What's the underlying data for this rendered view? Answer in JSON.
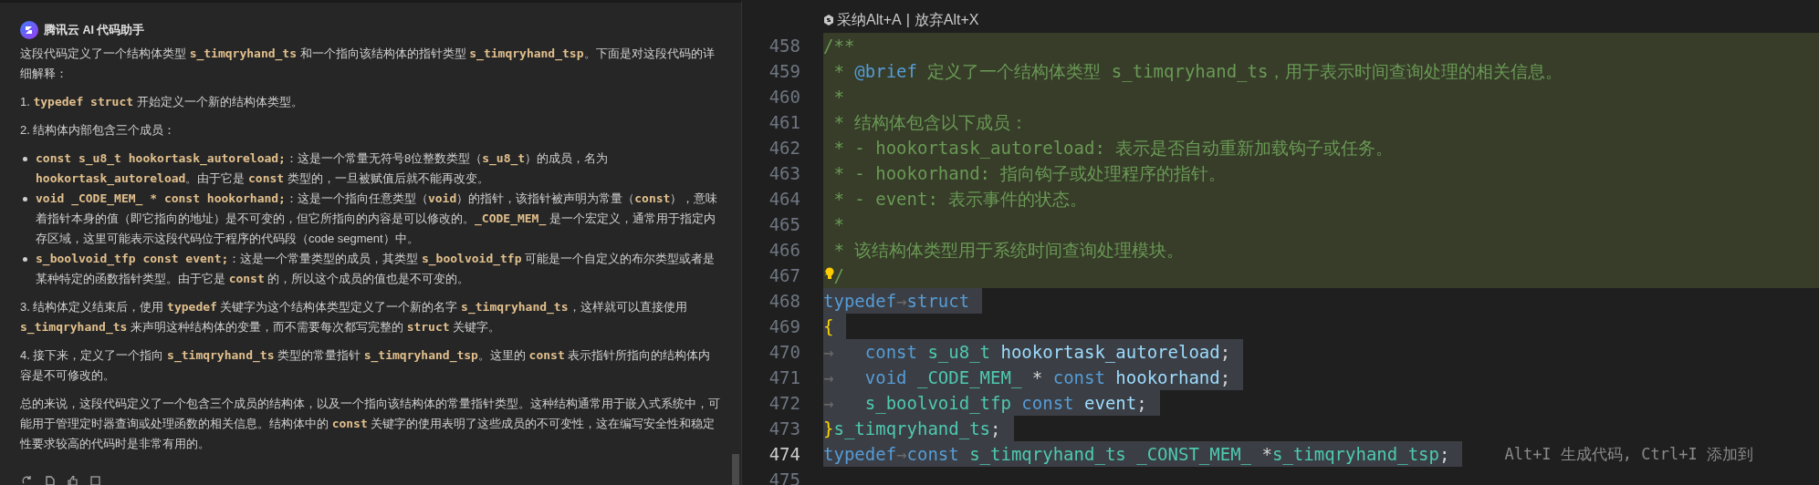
{
  "assistant": {
    "title": "腾讯云 AI 代码助手",
    "blocks": [
      {
        "kind": "paragraph",
        "parts": [
          {
            "text": "这段代码定义了一个结构体类型 ",
            "kind": "text"
          },
          {
            "text": "s_timqryhand_ts",
            "kind": "code"
          },
          {
            "text": " 和一个指向该结构体的指针类型 ",
            "kind": "text"
          },
          {
            "text": "s_timqryhand_tsp",
            "kind": "code"
          },
          {
            "text": "。下面是对这段代码的详细解释：",
            "kind": "text"
          }
        ]
      },
      {
        "kind": "paragraph",
        "parts": [
          {
            "text": "1. ",
            "kind": "text"
          },
          {
            "text": "typedef struct",
            "kind": "code"
          },
          {
            "text": " 开始定义一个新的结构体类型。",
            "kind": "text"
          }
        ]
      },
      {
        "kind": "paragraph",
        "parts": [
          {
            "text": "2. 结构体内部包含三个成员：",
            "kind": "text"
          }
        ]
      },
      {
        "kind": "bullets",
        "items": [
          {
            "parts": [
              {
                "text": "const s_u8_t hookortask_autoreload;",
                "kind": "code"
              },
              {
                "text": "：这是一个常量无符号8位整数类型（",
                "kind": "text"
              },
              {
                "text": "s_u8_t",
                "kind": "code"
              },
              {
                "text": "）的成员，名为 ",
                "kind": "text"
              },
              {
                "text": "hookortask_autoreload",
                "kind": "code"
              },
              {
                "text": "。由于它是 ",
                "kind": "text"
              },
              {
                "text": "const",
                "kind": "code"
              },
              {
                "text": " 类型的，一旦被赋值后就不能再改变。",
                "kind": "text"
              }
            ]
          },
          {
            "parts": [
              {
                "text": "void _CODE_MEM_ * const hookorhand;",
                "kind": "code"
              },
              {
                "text": "：这是一个指向任意类型（",
                "kind": "text"
              },
              {
                "text": "void",
                "kind": "code"
              },
              {
                "text": "）的指针，该指针被声明为常量（",
                "kind": "text"
              },
              {
                "text": "const",
                "kind": "code"
              },
              {
                "text": "），意味着指针本身的值（即它指向的地址）是不可变的，但它所指向的内容是可以修改的。",
                "kind": "text"
              },
              {
                "text": "_CODE_MEM_",
                "kind": "code"
              },
              {
                "text": " 是一个宏定义，通常用于指定内存区域，这里可能表示这段代码位于程序的代码段（code segment）中。",
                "kind": "text"
              }
            ]
          },
          {
            "parts": [
              {
                "text": "s_boolvoid_tfp const event;",
                "kind": "code"
              },
              {
                "text": "：这是一个常量类型的成员，其类型 ",
                "kind": "text"
              },
              {
                "text": "s_boolvoid_tfp",
                "kind": "code"
              },
              {
                "text": " 可能是一个自定义的布尔类型或者是某种特定的函数指针类型。由于它是 ",
                "kind": "text"
              },
              {
                "text": "const",
                "kind": "code"
              },
              {
                "text": " 的，所以这个成员的值也是不可变的。",
                "kind": "text"
              }
            ]
          }
        ]
      },
      {
        "kind": "paragraph",
        "parts": [
          {
            "text": "3. 结构体定义结束后，使用 ",
            "kind": "text"
          },
          {
            "text": "typedef",
            "kind": "code"
          },
          {
            "text": " 关键字为这个结构体类型定义了一个新的名字 ",
            "kind": "text"
          },
          {
            "text": "s_timqryhand_ts",
            "kind": "code"
          },
          {
            "text": "，这样就可以直接使用 ",
            "kind": "text"
          },
          {
            "text": "s_timqryhand_ts",
            "kind": "code"
          },
          {
            "text": " 来声明这种结构体的变量，而不需要每次都写完整的 ",
            "kind": "text"
          },
          {
            "text": "struct",
            "kind": "code"
          },
          {
            "text": " 关键字。",
            "kind": "text"
          }
        ]
      },
      {
        "kind": "paragraph",
        "parts": [
          {
            "text": "4. 接下来，定义了一个指向 ",
            "kind": "text"
          },
          {
            "text": "s_timqryhand_ts",
            "kind": "code"
          },
          {
            "text": " 类型的常量指针 ",
            "kind": "text"
          },
          {
            "text": "s_timqryhand_tsp",
            "kind": "code"
          },
          {
            "text": "。这里的 ",
            "kind": "text"
          },
          {
            "text": "const",
            "kind": "code"
          },
          {
            "text": " 表示指针所指向的结构体内容是不可修改的。",
            "kind": "text"
          }
        ]
      },
      {
        "kind": "paragraph",
        "parts": [
          {
            "text": "总的来说，这段代码定义了一个包含三个成员的结构体，以及一个指向该结构体的常量指针类型。这种结构通常用于嵌入式系统中，可能用于管理定时器查询或处理函数的相关信息。结构体中的 ",
            "kind": "text"
          },
          {
            "text": "const",
            "kind": "code"
          },
          {
            "text": " 关键字的使用表明了这些成员的不可变性，这在编写安全性和稳定性要求较高的代码时是非常有用的。",
            "kind": "text"
          }
        ]
      }
    ]
  },
  "editor": {
    "codelens": {
      "actions": [
        "采纳Alt+A",
        "放弃Alt+X"
      ],
      "separator": "|"
    },
    "lines": [
      {
        "number": "458",
        "kind": "suggestion",
        "current": false,
        "lightbulb": false,
        "tokens": [
          {
            "text": "/**",
            "kind": "comment"
          }
        ]
      },
      {
        "number": "459",
        "kind": "suggestion",
        "current": false,
        "lightbulb": false,
        "tokens": [
          {
            "text": " * ",
            "kind": "comment"
          },
          {
            "text": "@brief",
            "kind": "tag"
          },
          {
            "text": " 定义了一个结构体类型 s_timqryhand_ts，用于表示时间查询处理的相关信息。",
            "kind": "comment"
          }
        ]
      },
      {
        "number": "460",
        "kind": "suggestion",
        "current": false,
        "lightbulb": false,
        "tokens": [
          {
            "text": " *",
            "kind": "comment"
          }
        ]
      },
      {
        "number": "461",
        "kind": "suggestion",
        "current": false,
        "lightbulb": false,
        "tokens": [
          {
            "text": " * 结构体包含以下成员：",
            "kind": "comment"
          }
        ]
      },
      {
        "number": "462",
        "kind": "suggestion",
        "current": false,
        "lightbulb": false,
        "tokens": [
          {
            "text": " * - hookortask_autoreload: 表示是否自动重新加载钩子或任务。",
            "kind": "comment"
          }
        ]
      },
      {
        "number": "463",
        "kind": "suggestion",
        "current": false,
        "lightbulb": false,
        "tokens": [
          {
            "text": " * - hookorhand: 指向钩子或处理程序的指针。",
            "kind": "comment"
          }
        ]
      },
      {
        "number": "464",
        "kind": "suggestion",
        "current": false,
        "lightbulb": false,
        "tokens": [
          {
            "text": " * - event: 表示事件的状态。",
            "kind": "comment"
          }
        ]
      },
      {
        "number": "465",
        "kind": "suggestion",
        "current": false,
        "lightbulb": false,
        "tokens": [
          {
            "text": " *",
            "kind": "comment"
          }
        ]
      },
      {
        "number": "466",
        "kind": "suggestion",
        "current": false,
        "lightbulb": false,
        "tokens": [
          {
            "text": " * 该结构体类型用于系统时间查询处理模块。",
            "kind": "comment"
          }
        ]
      },
      {
        "number": "467",
        "kind": "suggestion",
        "current": false,
        "lightbulb": true,
        "tokens": [
          {
            "text": "*/",
            "kind": "comment"
          }
        ]
      },
      {
        "number": "468",
        "kind": "selection",
        "current": false,
        "lightbulb": false,
        "tokens": [
          {
            "text": "typedef",
            "kind": "keyword"
          },
          {
            "text": "→",
            "kind": "whitespace"
          },
          {
            "text": "struct",
            "kind": "keyword"
          }
        ]
      },
      {
        "number": "469",
        "kind": "selection",
        "current": false,
        "lightbulb": false,
        "tokens": [
          {
            "text": "{",
            "kind": "brace"
          }
        ]
      },
      {
        "number": "470",
        "kind": "selection",
        "current": false,
        "lightbulb": false,
        "tokens": [
          {
            "text": "→   ",
            "kind": "whitespace"
          },
          {
            "text": "const ",
            "kind": "keyword"
          },
          {
            "text": "s_u8_t ",
            "kind": "type"
          },
          {
            "text": "hookortask_autoreload",
            "kind": "variable"
          },
          {
            "text": ";",
            "kind": "plain"
          }
        ]
      },
      {
        "number": "471",
        "kind": "selection",
        "current": false,
        "lightbulb": false,
        "tokens": [
          {
            "text": "→   ",
            "kind": "whitespace"
          },
          {
            "text": "void ",
            "kind": "keyword"
          },
          {
            "text": "_CODE_MEM_",
            "kind": "type"
          },
          {
            "text": " * ",
            "kind": "plain"
          },
          {
            "text": "const ",
            "kind": "keyword"
          },
          {
            "text": "hookorhand",
            "kind": "variable"
          },
          {
            "text": ";",
            "kind": "plain"
          }
        ]
      },
      {
        "number": "472",
        "kind": "selection",
        "current": false,
        "lightbulb": false,
        "tokens": [
          {
            "text": "→   ",
            "kind": "whitespace"
          },
          {
            "text": "s_boolvoid_tfp ",
            "kind": "type"
          },
          {
            "text": "const ",
            "kind": "keyword"
          },
          {
            "text": "event",
            "kind": "variable"
          },
          {
            "text": ";",
            "kind": "plain"
          }
        ]
      },
      {
        "number": "473",
        "kind": "selection",
        "current": false,
        "lightbulb": false,
        "tokens": [
          {
            "text": "}",
            "kind": "brace"
          },
          {
            "text": "s_timqryhand_ts",
            "kind": "type"
          },
          {
            "text": ";",
            "kind": "plain"
          }
        ]
      },
      {
        "number": "474",
        "kind": "selection",
        "current": true,
        "lightbulb": false,
        "hint": "Alt+I 生成代码, Ctrl+I 添加到",
        "tokens": [
          {
            "text": "typedef",
            "kind": "keyword"
          },
          {
            "text": "→",
            "kind": "whitespace"
          },
          {
            "text": "const ",
            "kind": "keyword"
          },
          {
            "text": "s_timqryhand_ts ",
            "kind": "type"
          },
          {
            "text": "_CONST_MEM_",
            "kind": "type"
          },
          {
            "text": " *",
            "kind": "plain"
          },
          {
            "text": "s_timqryhand_tsp",
            "kind": "type"
          },
          {
            "text": ";",
            "kind": "plain"
          }
        ]
      },
      {
        "number": "475",
        "kind": "plain",
        "current": false,
        "lightbulb": false
      }
    ]
  }
}
